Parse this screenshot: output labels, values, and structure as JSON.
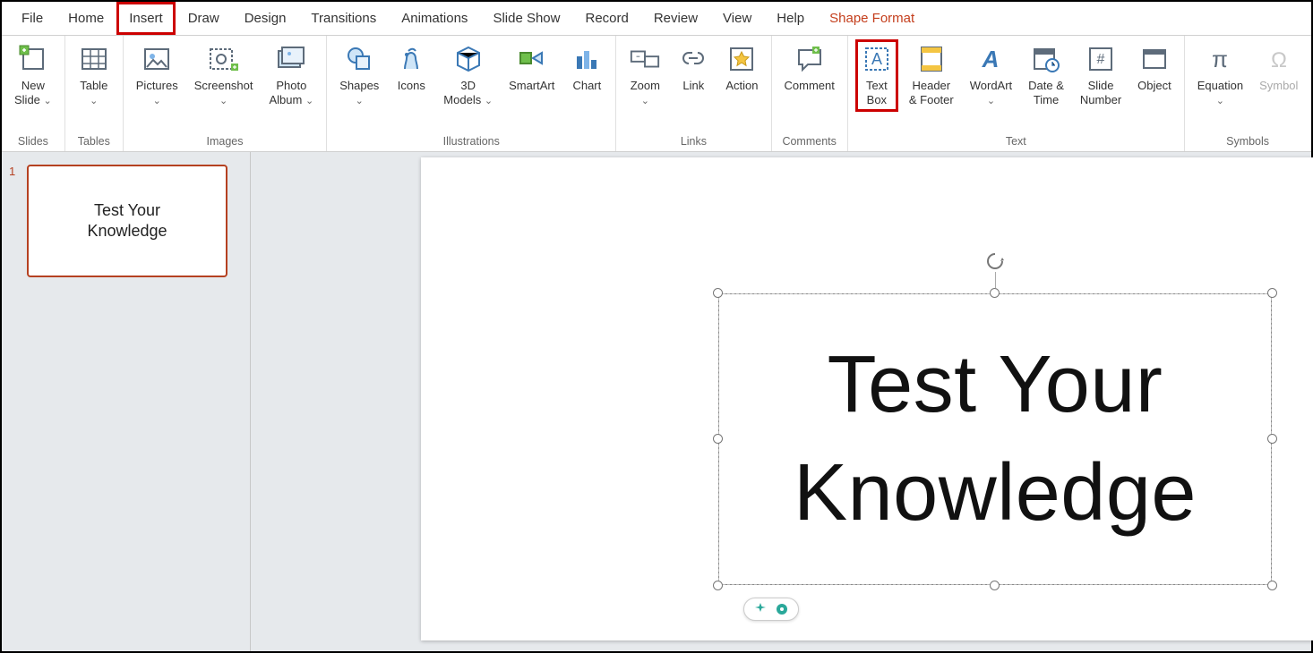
{
  "menu": {
    "file": "File",
    "home": "Home",
    "insert": "Insert",
    "draw": "Draw",
    "design": "Design",
    "transitions": "Transitions",
    "animations": "Animations",
    "slideshow": "Slide Show",
    "record": "Record",
    "review": "Review",
    "view": "View",
    "help": "Help",
    "shapeformat": "Shape Format"
  },
  "ribbon": {
    "slides": {
      "label": "Slides",
      "newslide": "New\nSlide"
    },
    "tables": {
      "label": "Tables",
      "table": "Table"
    },
    "images": {
      "label": "Images",
      "pictures": "Pictures",
      "screenshot": "Screenshot",
      "photoalbum": "Photo\nAlbum"
    },
    "illustrations": {
      "label": "Illustrations",
      "shapes": "Shapes",
      "icons": "Icons",
      "models": "3D\nModels",
      "smartart": "SmartArt",
      "chart": "Chart"
    },
    "links": {
      "label": "Links",
      "zoom": "Zoom",
      "link": "Link",
      "action": "Action"
    },
    "comments": {
      "label": "Comments",
      "comment": "Comment"
    },
    "text": {
      "label": "Text",
      "textbox": "Text\nBox",
      "headerfooter": "Header\n& Footer",
      "wordart": "WordArt",
      "datetime": "Date &\nTime",
      "slidenumber": "Slide\nNumber",
      "object": "Object"
    },
    "symbols": {
      "label": "Symbols",
      "equation": "Equation",
      "symbol": "Symbol"
    }
  },
  "thumb": {
    "num": "1",
    "title": "Test Your\nKnowledge"
  },
  "slide": {
    "title": "Test Your\nKnowledge"
  }
}
